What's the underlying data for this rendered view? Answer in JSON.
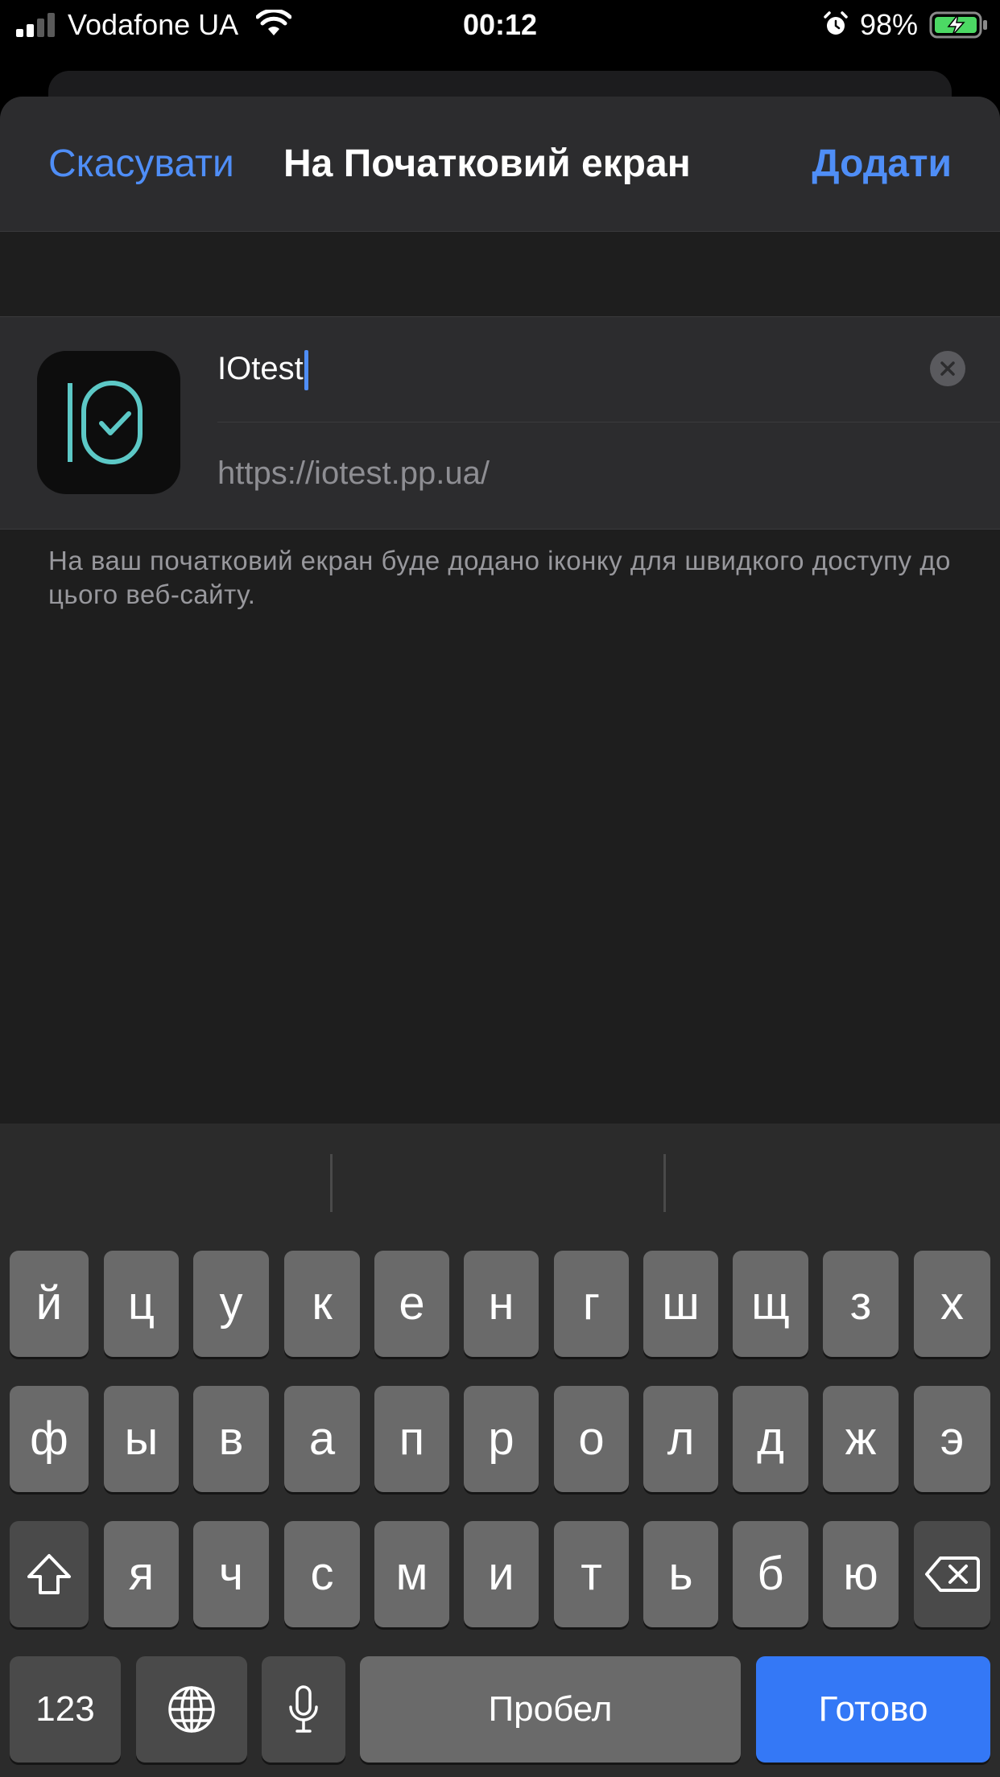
{
  "status_bar": {
    "carrier": "Vodafone UA",
    "time": "00:12",
    "battery_percent": "98%",
    "icons": [
      "signal-icon",
      "wifi-icon",
      "alarm-icon",
      "battery-charging-icon"
    ]
  },
  "sheet": {
    "cancel_label": "Скасувати",
    "title": "На Початковий екран",
    "add_label": "Додати"
  },
  "form": {
    "app_icon": "iotest-app-icon",
    "name_value": "IOtest",
    "url": "https://iotest.pp.ua/",
    "clear_icon": "clear-icon"
  },
  "hint_text": "На ваш початковий екран буде додано іконку для швидкого доступу до цього веб-сайту.",
  "keyboard": {
    "row1": [
      "й",
      "ц",
      "у",
      "к",
      "е",
      "н",
      "г",
      "ш",
      "щ",
      "з",
      "х"
    ],
    "row2": [
      "ф",
      "ы",
      "в",
      "а",
      "п",
      "р",
      "о",
      "л",
      "д",
      "ж",
      "э"
    ],
    "row3": [
      "я",
      "ч",
      "с",
      "м",
      "и",
      "т",
      "ь",
      "б",
      "ю"
    ],
    "numbers_label": "123",
    "space_label": "Пробел",
    "done_label": "Готово",
    "icons": [
      "shift-icon",
      "backspace-icon",
      "globe-icon",
      "microphone-icon"
    ]
  },
  "colors": {
    "accent": "#4f8ef7",
    "done_key": "#3478f6",
    "icon_teal": "#5cc8c6",
    "battery_green": "#4cd964"
  }
}
